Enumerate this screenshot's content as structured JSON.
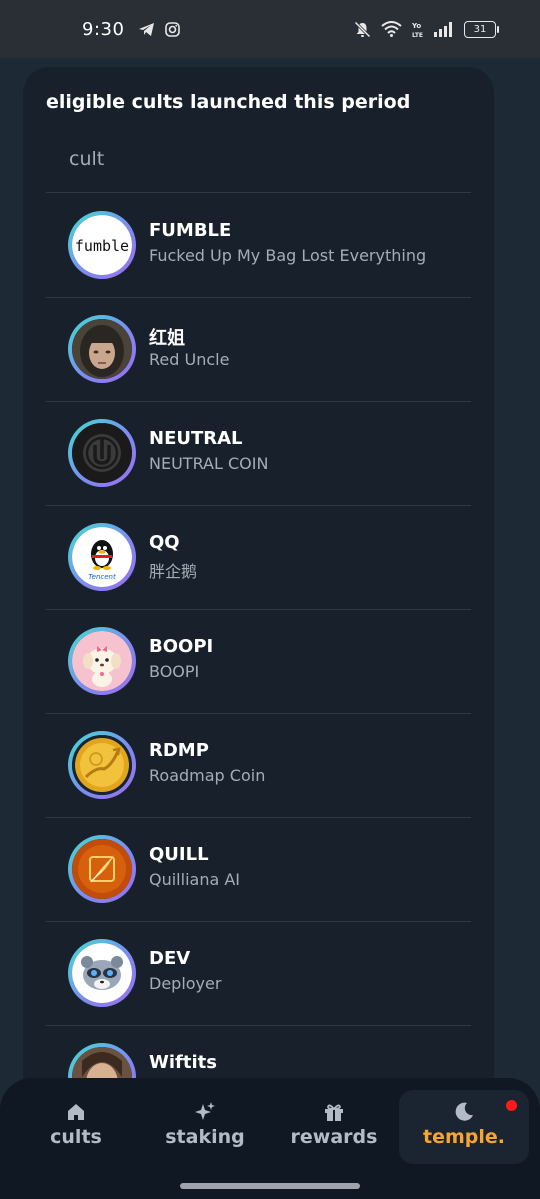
{
  "status_bar": {
    "time": "9:30",
    "battery": "31",
    "icons": [
      "telegram-icon",
      "instagram-icon",
      "mute-icon",
      "wifi-icon",
      "volte-icon",
      "signal-icon",
      "battery-icon"
    ]
  },
  "panel": {
    "title": "eligible cults launched this period",
    "column_header": "cult"
  },
  "cults": [
    {
      "symbol": "FUMBLE",
      "name": "Fucked Up My Bag Lost Everything",
      "avatar": "fumble-logo"
    },
    {
      "symbol": "红姐",
      "name": "Red Uncle",
      "avatar": "portrait-photo"
    },
    {
      "symbol": "NEUTRAL",
      "name": "NEUTRAL COIN",
      "avatar": "neutral-logo"
    },
    {
      "symbol": "QQ",
      "name": "胖企鹅",
      "avatar": "qq-penguin-logo"
    },
    {
      "symbol": "BOOPI",
      "name": "BOOPI",
      "avatar": "pink-puppy"
    },
    {
      "symbol": "RDMP",
      "name": "Roadmap Coin",
      "avatar": "gold-coin"
    },
    {
      "symbol": "QUILL",
      "name": "Quilliana AI",
      "avatar": "quill-logo"
    },
    {
      "symbol": "DEV",
      "name": "Deployer",
      "avatar": "raccoon-face"
    },
    {
      "symbol": "Wiftits",
      "name": "",
      "avatar": "partial-avatar"
    }
  ],
  "nav": {
    "items": [
      {
        "label": "cults",
        "icon": "home-icon"
      },
      {
        "label": "staking",
        "icon": "sparkles-icon"
      },
      {
        "label": "rewards",
        "icon": "gift-icon"
      },
      {
        "label": "temple.",
        "icon": "moon-icon",
        "active": true
      }
    ]
  },
  "colors": {
    "background": "#1d2935",
    "panel": "#18212b",
    "accent": "#f7a531",
    "muted_text": "#a4acb6",
    "notification": "#ff1a1a"
  }
}
